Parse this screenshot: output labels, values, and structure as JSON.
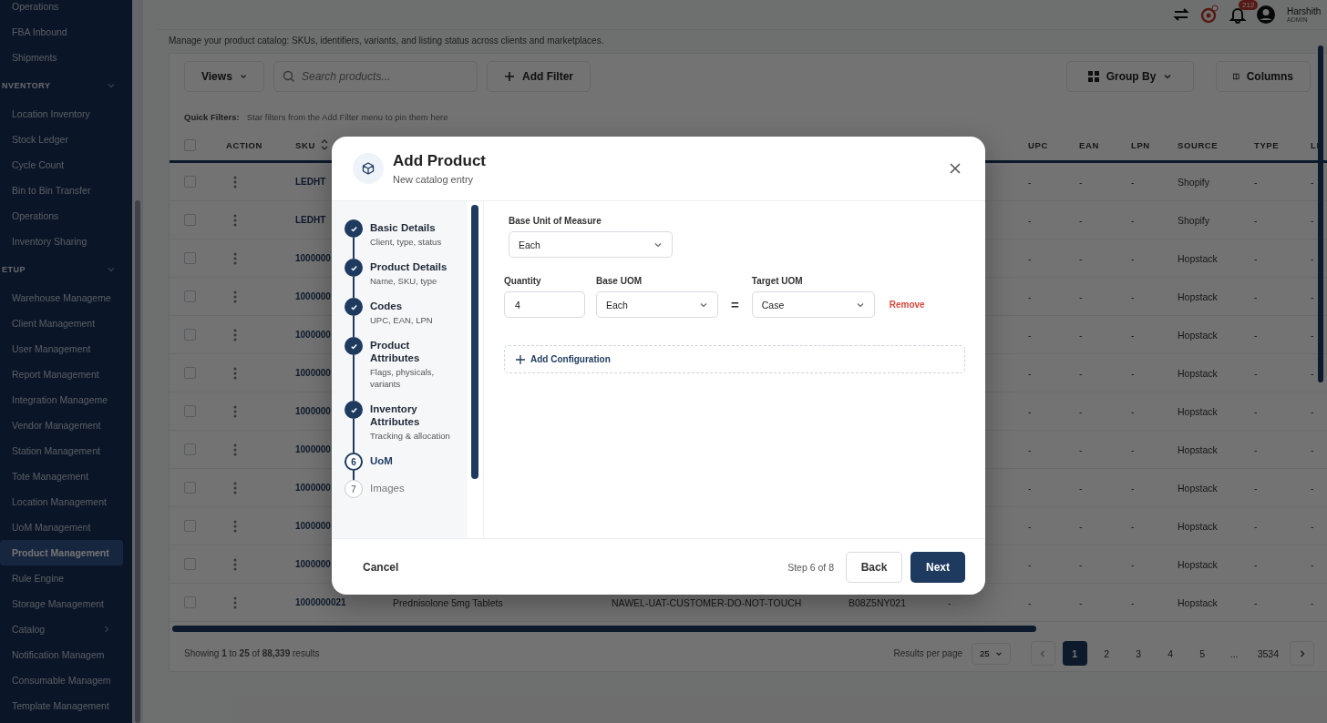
{
  "sidebar": {
    "items": [
      {
        "kind": "item",
        "label": "Operations",
        "selected": false
      },
      {
        "kind": "item",
        "label": "FBA Inbound",
        "selected": false
      },
      {
        "kind": "item",
        "label": "Shipments",
        "selected": false
      },
      {
        "kind": "section",
        "label": "NVENTORY"
      },
      {
        "kind": "item",
        "label": "Location Inventory",
        "selected": false
      },
      {
        "kind": "item",
        "label": "Stock Ledger",
        "selected": false
      },
      {
        "kind": "item",
        "label": "Cycle Count",
        "selected": false
      },
      {
        "kind": "item",
        "label": "Bin to Bin Transfer",
        "selected": false
      },
      {
        "kind": "item",
        "label": "Operations",
        "selected": false
      },
      {
        "kind": "item",
        "label": "Inventory Sharing",
        "selected": false
      },
      {
        "kind": "section",
        "label": "ETUP"
      },
      {
        "kind": "item",
        "label": "Warehouse Manageme",
        "selected": false
      },
      {
        "kind": "item",
        "label": "Client Management",
        "selected": false
      },
      {
        "kind": "item",
        "label": "User Management",
        "selected": false
      },
      {
        "kind": "item",
        "label": "Report Management",
        "selected": false
      },
      {
        "kind": "item",
        "label": "Integration Manageme",
        "selected": false
      },
      {
        "kind": "item",
        "label": "Vendor Management",
        "selected": false
      },
      {
        "kind": "item",
        "label": "Station Management",
        "selected": false
      },
      {
        "kind": "item",
        "label": "Tote Management",
        "selected": false
      },
      {
        "kind": "item",
        "label": "Location Management",
        "selected": false
      },
      {
        "kind": "item",
        "label": "UoM Management",
        "selected": false
      },
      {
        "kind": "item",
        "label": "Product Management",
        "selected": true
      },
      {
        "kind": "item",
        "label": "Rule Engine",
        "selected": false
      },
      {
        "kind": "item",
        "label": "Storage Management",
        "selected": false
      },
      {
        "kind": "group",
        "label": "Catalog",
        "selected": false
      },
      {
        "kind": "item",
        "label": "Notification Managem",
        "selected": false
      },
      {
        "kind": "item",
        "label": "Consumable Managem",
        "selected": false
      },
      {
        "kind": "item",
        "label": "Template Management",
        "selected": false
      }
    ]
  },
  "header": {
    "notification_count": "212",
    "user_name": "Harshith",
    "user_role": "ADMIN"
  },
  "description": "Manage your product catalog: SKUs, identifiers, variants, and listing status across clients and marketplaces.",
  "toolbar": {
    "views": "Views",
    "search_placeholder": "Search products...",
    "add_filter": "Add Filter",
    "group_by": "Group By",
    "columns": "Columns"
  },
  "quick_filters": {
    "label": "Quick Filters:",
    "hint": "Star filters from the Add Filter menu to pin them here"
  },
  "table": {
    "select_all_checked": false,
    "action_header": "ACTION",
    "sku_header": "SKU",
    "upc_header": "UPC",
    "ean_header": "EAN",
    "lpn_header": "LPN",
    "source_header": "SOURCE",
    "type_header": "TYPE",
    "column_11_header": "LI",
    "rows": [
      {
        "checked": false,
        "sku": "LEDHT",
        "upc": "-",
        "ean": "-",
        "lpn": "-",
        "source": "Shopify",
        "type": "-",
        "column_11": "-"
      },
      {
        "checked": false,
        "sku": "LEDHT",
        "upc": "-",
        "ean": "-",
        "lpn": "-",
        "source": "Shopify",
        "type": "-",
        "column_11": "-"
      },
      {
        "checked": false,
        "sku": "1000000",
        "upc": "-",
        "ean": "-",
        "lpn": "-",
        "source": "Hopstack",
        "type": "-",
        "column_11": "-"
      },
      {
        "checked": false,
        "sku": "1000000",
        "upc": "-",
        "ean": "-",
        "lpn": "-",
        "source": "Hopstack",
        "type": "-",
        "column_11": "-"
      },
      {
        "checked": false,
        "sku": "1000000",
        "upc": "-",
        "ean": "-",
        "lpn": "-",
        "source": "Hopstack",
        "type": "-",
        "column_11": "-"
      },
      {
        "checked": false,
        "sku": "1000000",
        "upc": "-",
        "ean": "-",
        "lpn": "-",
        "source": "Hopstack",
        "type": "-",
        "column_11": "-"
      },
      {
        "checked": false,
        "sku": "1000000",
        "upc": "-",
        "ean": "-",
        "lpn": "-",
        "source": "Hopstack",
        "type": "-",
        "column_11": "-"
      },
      {
        "checked": false,
        "sku": "1000000",
        "upc": "-",
        "ean": "-",
        "lpn": "-",
        "source": "Hopstack",
        "type": "-",
        "column_11": "-"
      },
      {
        "checked": false,
        "sku": "1000000",
        "upc": "-",
        "ean": "-",
        "lpn": "-",
        "source": "Hopstack",
        "type": "-",
        "column_11": "-"
      },
      {
        "checked": false,
        "sku": "1000000",
        "upc": "-",
        "ean": "-",
        "lpn": "-",
        "source": "Hopstack",
        "type": "-",
        "column_11": "-"
      },
      {
        "checked": false,
        "sku": "1000000",
        "upc": "-",
        "ean": "-",
        "lpn": "-",
        "source": "Hopstack",
        "type": "-",
        "column_11": "-"
      },
      {
        "checked": false,
        "sku": "1000000021",
        "name": "Prednisolone 5mg Tablets",
        "client": "NAWEL-UAT-CUSTOMER-DO-NOT-TOUCH",
        "asin": "B08Z5NY021",
        "column_5": "-",
        "upc": "-",
        "ean": "-",
        "lpn": "-",
        "source": "Hopstack",
        "type": "-",
        "column_11": "-"
      }
    ]
  },
  "pagination": {
    "summary": "Showing **1** to **25** of **88,339** results",
    "per_page_label": "Results per page",
    "per_page": "25",
    "pages": [
      {
        "label": "1",
        "selected": true
      },
      {
        "label": "2",
        "selected": false
      },
      {
        "label": "3",
        "selected": false
      },
      {
        "label": "4",
        "selected": false
      },
      {
        "label": "5",
        "selected": false
      },
      {
        "label": "...",
        "selected": false
      },
      {
        "label": "3534",
        "selected": false
      }
    ]
  },
  "modal": {
    "title": "Add Product",
    "subtitle": "New catalog entry",
    "steps": [
      {
        "title": "Basic Details",
        "description": "Client, type, status",
        "completed": true,
        "current": false
      },
      {
        "title": "Product Details",
        "description": "Name, SKU, type",
        "completed": true,
        "current": false
      },
      {
        "title": "Codes",
        "description": "UPC, EAN, LPN",
        "completed": true,
        "current": false
      },
      {
        "title": "Product Attributes",
        "description": "Flags, physicals, variants",
        "completed": true,
        "current": false
      },
      {
        "title": "Inventory Attributes",
        "description": "Tracking & allocation",
        "completed": true,
        "current": false
      },
      {
        "number": "6",
        "title": "UoM",
        "completed": false,
        "current": true
      },
      {
        "number": "7",
        "title": "Images",
        "completed": false,
        "current": false
      }
    ],
    "base_uom": {
      "label": "Base Unit of Measure",
      "value": "Each"
    },
    "conversions": [
      {
        "quantity": {
          "label": "Quantity",
          "value": "4"
        },
        "base": {
          "label": "Base UOM",
          "value": "Each"
        },
        "equals": "=",
        "target": {
          "label": "Target UOM",
          "value": "Case"
        },
        "remove": "Remove"
      }
    ],
    "add_configuration": "Add Configuration",
    "cancel": "Cancel",
    "step_indicator": "Step 6 of 8",
    "back": "Back",
    "next": "Next"
  }
}
